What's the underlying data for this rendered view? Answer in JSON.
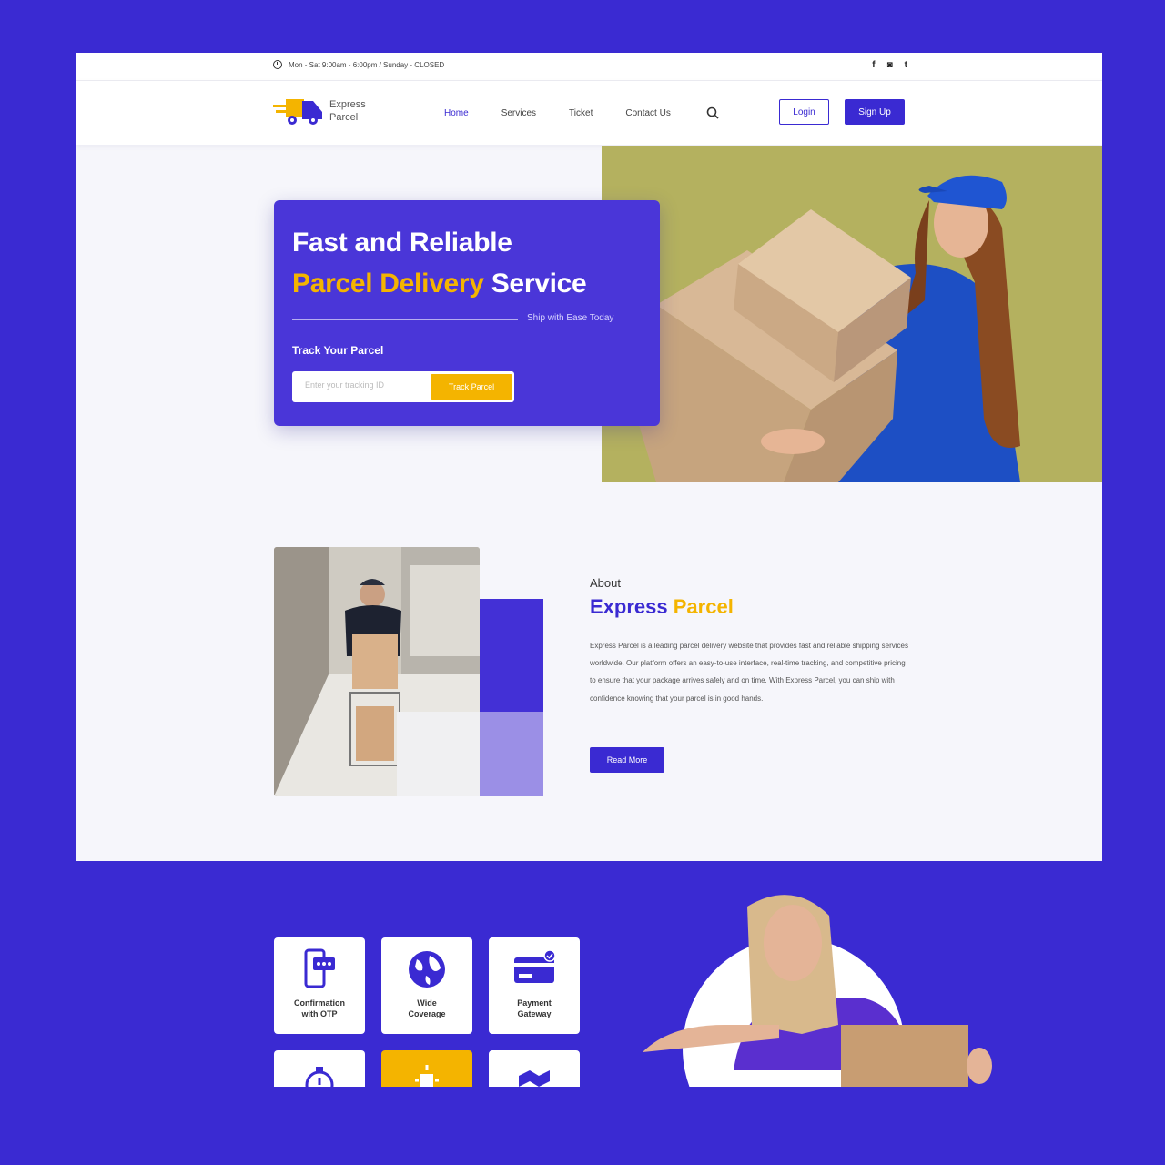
{
  "topbar": {
    "hours": "Mon - Sat 9:00am - 6:00pm / Sunday - CLOSED",
    "social": [
      "f",
      "◙",
      "t"
    ]
  },
  "brand": {
    "line1": "Express",
    "line2": "Parcel"
  },
  "nav": {
    "items": [
      {
        "label": "Home",
        "active": true
      },
      {
        "label": "Services"
      },
      {
        "label": "Ticket"
      },
      {
        "label": "Contact Us"
      }
    ],
    "login": "Login",
    "signup": "Sign Up"
  },
  "hero": {
    "line1": "Fast and Reliable",
    "line2_highlight": "Parcel Delivery",
    "line2_rest": "Service",
    "tagline": "Ship with Ease Today",
    "track_label": "Track Your Parcel",
    "track_placeholder": "Enter your tracking ID",
    "track_button": "Track Parcel"
  },
  "about": {
    "subtitle": "About",
    "title_main": "Express",
    "title_highlight": "Parcel",
    "text": "Express Parcel is a leading parcel delivery website that provides fast and reliable shipping services worldwide. Our platform offers an easy-to-use interface, real-time tracking, and competitive pricing to ensure that your package arrives safely and on time. With Express Parcel, you can ship with confidence knowing that your parcel is in good hands.",
    "button": "Read More"
  },
  "features": [
    {
      "line1": "Confirmation",
      "line2": "with OTP",
      "icon": "phone-otp-icon"
    },
    {
      "line1": "Wide",
      "line2": "Coverage",
      "icon": "globe-icon"
    },
    {
      "line1": "Payment",
      "line2": "Gateway",
      "icon": "credit-card-icon"
    }
  ],
  "colors": {
    "brand": "#3a2ad2",
    "accent": "#f4b400"
  }
}
